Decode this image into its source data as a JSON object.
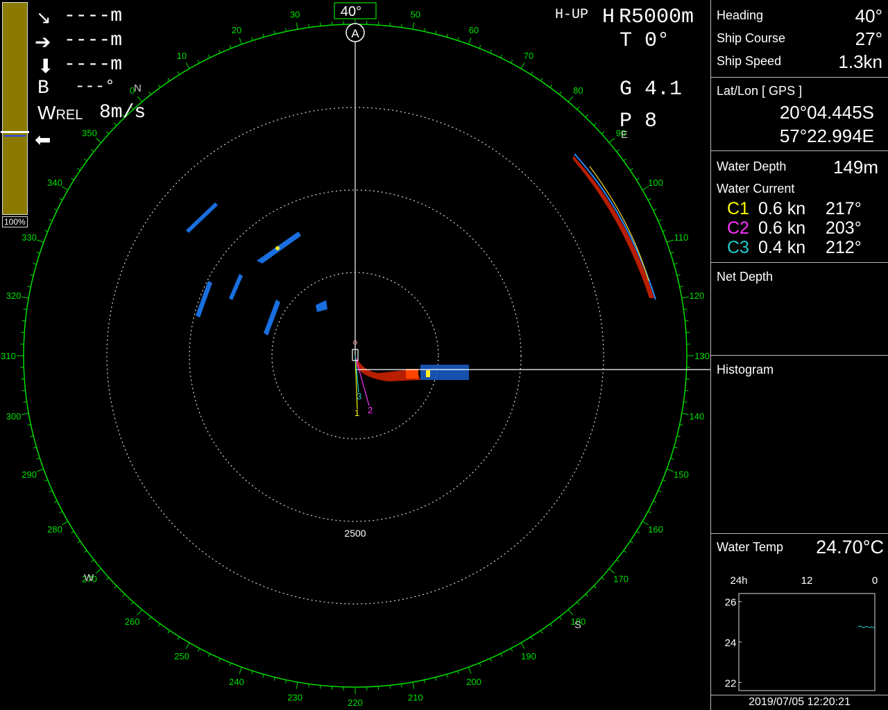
{
  "colors": {
    "ring": "#00e000",
    "c1": "#ffff00",
    "c2": "#ff33ff",
    "c3": "#22cccc",
    "gauge": "#8a7b00"
  },
  "sonar": {
    "heading_box": "40°",
    "mode": "H-UP",
    "range_prefix": "H",
    "range": "R5000m",
    "tilt": "T  0°",
    "gain": "G 4.1",
    "pulse": "P  8",
    "ring_label": "2500",
    "marker_letter": "A",
    "compass_letters": {
      "n": "N",
      "e": "E",
      "s": "S",
      "w": "W"
    },
    "bearing_labels": [
      "0",
      "10",
      "20",
      "30",
      "40",
      "50",
      "60",
      "70",
      "80",
      "90",
      "100",
      "110",
      "120",
      "130",
      "140",
      "150",
      "160",
      "170",
      "180",
      "190",
      "200",
      "210",
      "220",
      "230",
      "240",
      "250",
      "260",
      "270",
      "280",
      "290",
      "300",
      "310",
      "320",
      "330",
      "340",
      "350"
    ],
    "current_labels": {
      "c1": "1",
      "c2": "2",
      "c3": "3"
    }
  },
  "overlay": {
    "dist1": "----m",
    "dist2": "----m",
    "dist3": "----m",
    "bearing_label": "B",
    "bearing_value": "---°",
    "wrel_label_w": "W",
    "wrel_label_rest": "REL",
    "wrel_value": "8m/s",
    "gauge_pct": "100%",
    "gauge_level": 0.37
  },
  "panel": {
    "heading_label": "Heading",
    "heading_value": "40°",
    "course_label": "Ship Course",
    "course_value": "27°",
    "speed_label": "Ship Speed",
    "speed_value": "1.3kn",
    "latlon_label": "Lat/Lon  [ GPS ]",
    "lat": "20°04.445S",
    "lon": "57°22.994E",
    "depth_label": "Water Depth",
    "depth_value": "149m",
    "current_label": "Water Current",
    "currents": [
      {
        "name": "C1",
        "speed": "0.6 kn",
        "dir": "217°"
      },
      {
        "name": "C2",
        "speed": "0.6 kn",
        "dir": "203°"
      },
      {
        "name": "C3",
        "speed": "0.4 kn",
        "dir": "212°"
      }
    ],
    "net_depth_label": "Net Depth",
    "histogram_label": "Histogram",
    "temp_label": "Water Temp",
    "temp_value": "24.70°C",
    "graph_x_labels": [
      "24h",
      "12",
      "0"
    ],
    "graph_y_labels": [
      "26",
      "24",
      "22"
    ],
    "datetime": "2019/07/05 12:20:21"
  },
  "chart_data": {
    "type": "line",
    "title": "",
    "xlabel": "",
    "ylabel": "",
    "x_ticks": [
      "24h",
      "12",
      "0"
    ],
    "ylim": [
      21.6,
      26.4
    ],
    "y_ticks": [
      26,
      24,
      22
    ],
    "series": [
      {
        "x_hours_ago": [
          3.0,
          2.5,
          2.0,
          1.5,
          1.0,
          0.5,
          0.0
        ],
        "values": [
          24.75,
          24.8,
          24.7,
          24.78,
          24.72,
          24.74,
          24.7
        ]
      }
    ]
  }
}
